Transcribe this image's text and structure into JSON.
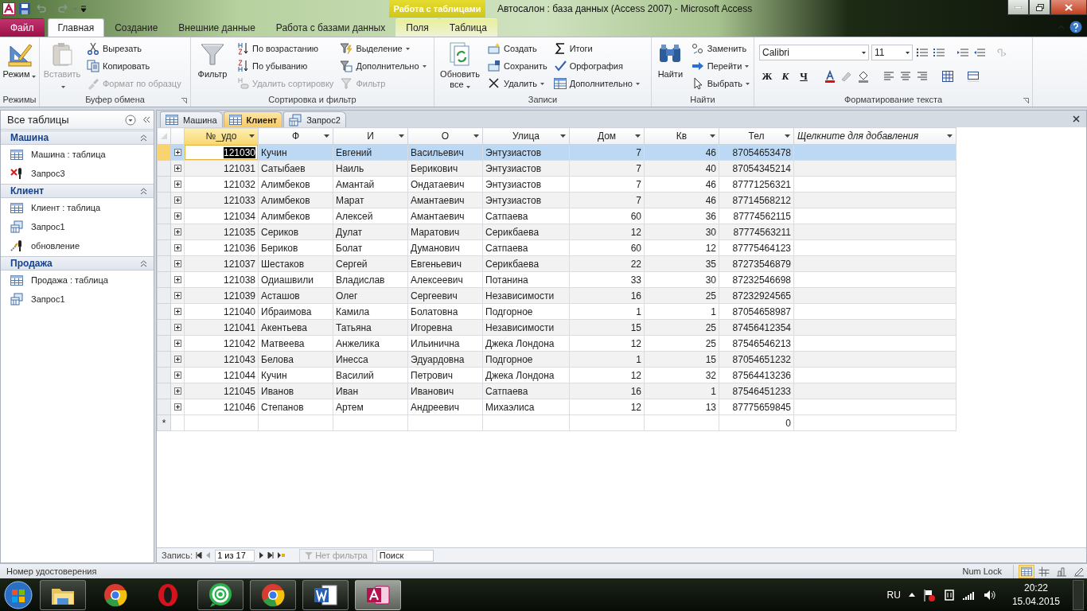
{
  "title_bar": {
    "title": "Автосалон : база данных (Access 2007)  -  Microsoft Access",
    "context_group": "Работа с таблицами"
  },
  "ribbon_tabs": [
    {
      "label": "Файл",
      "kind": "file",
      "selected": false
    },
    {
      "label": "Главная",
      "kind": "normal",
      "selected": true
    },
    {
      "label": "Создание",
      "kind": "normal",
      "selected": false
    },
    {
      "label": "Внешние данные",
      "kind": "normal",
      "selected": false
    },
    {
      "label": "Работа с базами данных",
      "kind": "normal",
      "selected": false
    },
    {
      "label": "Поля",
      "kind": "context",
      "selected": false
    },
    {
      "label": "Таблица",
      "kind": "context",
      "selected": false
    }
  ],
  "ribbon_groups": [
    {
      "label": "Режимы",
      "launcher": false,
      "items": [
        {
          "label": "Режим",
          "kind": "large",
          "disabled": false,
          "dropdown": true
        }
      ]
    },
    {
      "label": "Буфер обмена",
      "launcher": true,
      "items": [
        {
          "label": "Вставить",
          "kind": "large",
          "disabled": true,
          "dropdown": true
        },
        {
          "label": "Вырезать",
          "kind": "small",
          "disabled": false,
          "dropdown": false
        },
        {
          "label": "Копировать",
          "kind": "small",
          "disabled": false,
          "dropdown": false
        },
        {
          "label": "Формат по образцу",
          "kind": "small",
          "disabled": true,
          "dropdown": false
        }
      ]
    },
    {
      "label": "Сортировка и фильтр",
      "launcher": false,
      "items": [
        {
          "label": "Фильтр",
          "kind": "large",
          "disabled": false,
          "dropdown": false
        },
        {
          "label": "По возрастанию",
          "kind": "small",
          "disabled": false,
          "dropdown": false
        },
        {
          "label": "По убыванию",
          "kind": "small",
          "disabled": false,
          "dropdown": false
        },
        {
          "label": "Удалить сортировку",
          "kind": "small",
          "disabled": true,
          "dropdown": false
        },
        {
          "label": "Выделение",
          "kind": "small",
          "disabled": false,
          "dropdown": true
        },
        {
          "label": "Дополнительно",
          "kind": "small",
          "disabled": false,
          "dropdown": true
        },
        {
          "label": "Фильтр",
          "kind": "small",
          "disabled": true,
          "dropdown": false
        }
      ]
    },
    {
      "label": "Записи",
      "launcher": false,
      "items": [
        {
          "label": "Обновить все",
          "kind": "large",
          "disabled": false,
          "dropdown": true
        },
        {
          "label": "Создать",
          "kind": "small",
          "disabled": false,
          "dropdown": false
        },
        {
          "label": "Сохранить",
          "kind": "small",
          "disabled": false,
          "dropdown": false
        },
        {
          "label": "Удалить",
          "kind": "small",
          "disabled": false,
          "dropdown": true
        },
        {
          "label": "Итоги",
          "kind": "small",
          "disabled": false,
          "dropdown": false
        },
        {
          "label": "Орфография",
          "kind": "small",
          "disabled": false,
          "dropdown": false
        },
        {
          "label": "Дополнительно",
          "kind": "small",
          "disabled": false,
          "dropdown": true
        }
      ]
    },
    {
      "label": "Найти",
      "launcher": false,
      "items": [
        {
          "label": "Найти",
          "kind": "large",
          "disabled": false,
          "dropdown": false
        },
        {
          "label": "Заменить",
          "kind": "small",
          "disabled": false,
          "dropdown": false
        },
        {
          "label": "Перейти",
          "kind": "small",
          "disabled": false,
          "dropdown": true
        },
        {
          "label": "Выбрать",
          "kind": "small",
          "disabled": false,
          "dropdown": true
        }
      ]
    }
  ],
  "text_format": {
    "label": "Форматирование текста",
    "font": "Calibri",
    "size": "11",
    "style_buttons": [
      "Ж",
      "К",
      "Ч"
    ]
  },
  "nav_pane": {
    "title": "Все таблицы",
    "groups": [
      {
        "label": "Машина",
        "items": [
          {
            "label": "Машина : таблица",
            "kind": "table"
          },
          {
            "label": "Запрос3",
            "kind": "delete_query"
          }
        ]
      },
      {
        "label": "Клиент",
        "items": [
          {
            "label": "Клиент : таблица",
            "kind": "table"
          },
          {
            "label": "Запрос1",
            "kind": "query"
          },
          {
            "label": "обновление",
            "kind": "update_query"
          }
        ]
      },
      {
        "label": "Продажа",
        "items": [
          {
            "label": "Продажа : таблица",
            "kind": "table"
          },
          {
            "label": "Запрос1",
            "kind": "query"
          }
        ]
      }
    ]
  },
  "doc_tabs": [
    {
      "label": "Машина",
      "kind": "table",
      "selected": false
    },
    {
      "label": "Клиент",
      "kind": "table",
      "selected": true
    },
    {
      "label": "Запрос2",
      "kind": "query",
      "selected": false
    }
  ],
  "table": {
    "columns": [
      {
        "label": "№_удо",
        "kind": "number",
        "selected": true
      },
      {
        "label": "Ф",
        "kind": "text",
        "selected": false
      },
      {
        "label": "И",
        "kind": "text",
        "selected": false
      },
      {
        "label": "О",
        "kind": "text",
        "selected": false
      },
      {
        "label": "Улица",
        "kind": "text",
        "selected": false
      },
      {
        "label": "Дом",
        "kind": "number",
        "selected": false
      },
      {
        "label": "Кв",
        "kind": "number",
        "selected": false
      },
      {
        "label": "Тел",
        "kind": "number",
        "selected": false
      }
    ],
    "add_column": "Щелкните для добавления",
    "rows": [
      {
        "selected": true,
        "cells": [
          "121030",
          "Кучин",
          "Евгений",
          "Васильевич",
          "Энтузиастов",
          "7",
          "46",
          "87054653478"
        ]
      },
      {
        "selected": false,
        "cells": [
          "121031",
          "Сатыбаев",
          "Наиль",
          "Берикович",
          "Энтузиастов",
          "7",
          "40",
          "87054345214"
        ]
      },
      {
        "selected": false,
        "cells": [
          "121032",
          "Алимбеков",
          "Амантай",
          "Ондатаевич",
          "Энтузиастов",
          "7",
          "46",
          "87771256321"
        ]
      },
      {
        "selected": false,
        "cells": [
          "121033",
          "Алимбеков",
          "Марат",
          "Амантаевич",
          "Энтузиастов",
          "7",
          "46",
          "87714568212"
        ]
      },
      {
        "selected": false,
        "cells": [
          "121034",
          "Алимбеков",
          "Алексей",
          "Амантаевич",
          "Сатпаева",
          "60",
          "36",
          "87774562115"
        ]
      },
      {
        "selected": false,
        "cells": [
          "121035",
          "Сериков",
          "Дулат",
          "Маратович",
          "Серикбаева",
          "12",
          "30",
          "87774563211"
        ]
      },
      {
        "selected": false,
        "cells": [
          "121036",
          "Бериков",
          "Болат",
          "Думанович",
          "Сатпаева",
          "60",
          "12",
          "87775464123"
        ]
      },
      {
        "selected": false,
        "cells": [
          "121037",
          "Шестаков",
          "Сергей",
          "Евгеньевич",
          "Серикбаева",
          "22",
          "35",
          "87273546879"
        ]
      },
      {
        "selected": false,
        "cells": [
          "121038",
          "Одиашвили",
          "Владислав",
          "Алексеевич",
          "Потанина",
          "33",
          "30",
          "87232546698"
        ]
      },
      {
        "selected": false,
        "cells": [
          "121039",
          "Асташов",
          "Олег",
          "Сергеевич",
          "Независимости",
          "16",
          "25",
          "87232924565"
        ]
      },
      {
        "selected": false,
        "cells": [
          "121040",
          "Ибраимова",
          "Камила",
          "Болатовна",
          "Подгорное",
          "1",
          "1",
          "87054658987"
        ]
      },
      {
        "selected": false,
        "cells": [
          "121041",
          "Акентьева",
          "Татьяна",
          "Игоревна",
          "Независимости",
          "15",
          "25",
          "87456412354"
        ]
      },
      {
        "selected": false,
        "cells": [
          "121042",
          "Матвеева",
          "Анжелика",
          "Ильинична",
          "Джека Лондона",
          "12",
          "25",
          "87546546213"
        ]
      },
      {
        "selected": false,
        "cells": [
          "121043",
          "Белова",
          "Инесса",
          "Эдуардовна",
          "Подгорное",
          "1",
          "15",
          "87054651232"
        ]
      },
      {
        "selected": false,
        "cells": [
          "121044",
          "Кучин",
          "Василий",
          "Петрович",
          "Джека Лондона",
          "12",
          "32",
          "87564413236"
        ]
      },
      {
        "selected": false,
        "cells": [
          "121045",
          "Иванов",
          "Иван",
          "Иванович",
          "Сатпаева",
          "16",
          "1",
          "87546451233"
        ]
      },
      {
        "selected": false,
        "cells": [
          "121046",
          "Степанов",
          "Артем",
          "Андреевич",
          "Михаэлиса",
          "12",
          "13",
          "87775659845"
        ]
      }
    ],
    "new_row": {
      "marker": "*",
      "default": "0"
    }
  },
  "record_nav": {
    "label": "Запись:",
    "position": "1 из 17",
    "filter": "Нет фильтра",
    "search_placeholder": "Поиск"
  },
  "status_bar": {
    "text": "Номер удостоверения",
    "num_lock": "Num Lock",
    "views": [
      {
        "kind": "datasheet",
        "selected": true
      },
      {
        "kind": "pivot_table",
        "selected": false
      },
      {
        "kind": "pivot_chart",
        "selected": false
      },
      {
        "kind": "design",
        "selected": false
      }
    ]
  },
  "taskbar": {
    "apps": [
      {
        "kind": "explorer",
        "open": true,
        "active": false
      },
      {
        "kind": "chrome",
        "open": false,
        "active": false
      },
      {
        "kind": "opera",
        "open": false,
        "active": false
      },
      {
        "kind": "mail",
        "open": true,
        "active": false
      },
      {
        "kind": "chrome",
        "open": true,
        "active": false
      },
      {
        "kind": "word",
        "open": true,
        "active": false
      },
      {
        "kind": "access",
        "open": true,
        "active": true
      }
    ],
    "language": "RU",
    "time": "20:22",
    "date": "15.04.2015"
  }
}
